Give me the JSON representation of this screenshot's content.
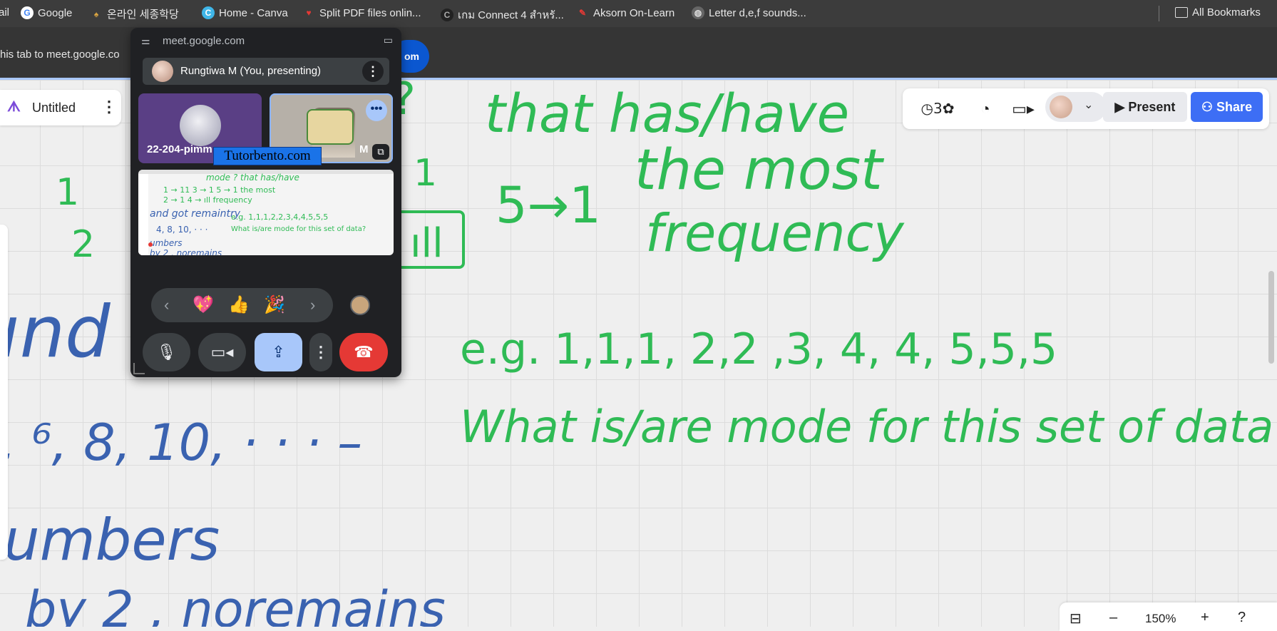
{
  "browser": {
    "bookmarks": [
      {
        "label": "ail",
        "icon": "none"
      },
      {
        "label": "Google",
        "icon": "google-icon"
      },
      {
        "label": "온라인 세종학당",
        "icon": "sejong-icon"
      },
      {
        "label": "Home - Canva",
        "icon": "canva-icon"
      },
      {
        "label": "Split PDF files onlin...",
        "icon": "pdf-icon"
      },
      {
        "label": "เกม Connect 4 สำหรั...",
        "icon": "game-icon"
      },
      {
        "label": "Aksorn On-Learn",
        "icon": "aksorn-icon"
      },
      {
        "label": "Letter d,e,f sounds...",
        "icon": "globe-icon"
      }
    ],
    "all_bookmarks": "All Bookmarks",
    "banner_text": "his tab to meet.google.co",
    "banner_button": "om"
  },
  "whiteboard": {
    "doc_title": "Untitled",
    "toolbar": {
      "present_label": "Present",
      "share_label": "Share"
    },
    "zoom_label": "150%"
  },
  "meet_popup": {
    "url": "meet.google.com",
    "presenter_label": "Rungtiwa M (You, presenting)",
    "tile1_name": "22-204-pimm",
    "tile2_name": "M",
    "watermark": "Tutorbento.com",
    "reactions": [
      "💖",
      "👍",
      "🎉"
    ]
  },
  "colors": {
    "accent": "#3d6ef5",
    "end_call": "#e53935",
    "ink_green": "#2fbb55",
    "ink_blue": "#3a62b0"
  }
}
